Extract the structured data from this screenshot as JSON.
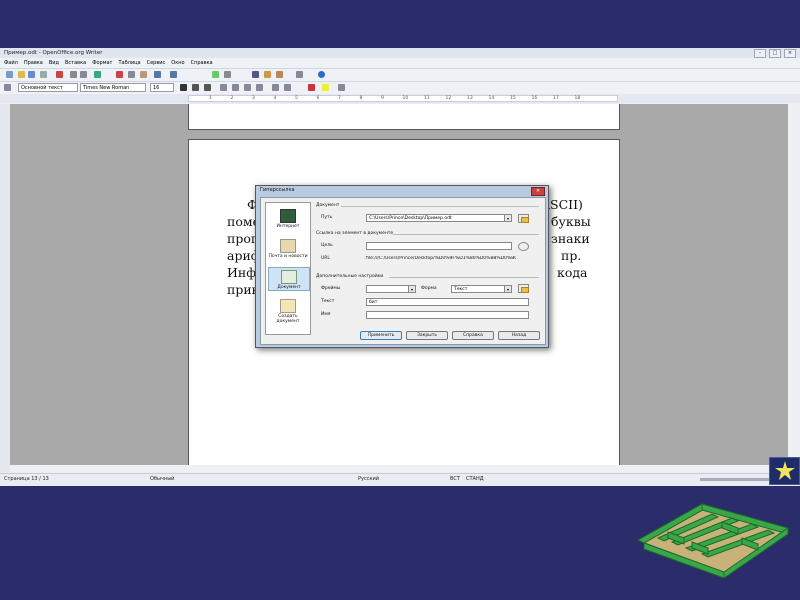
{
  "window": {
    "title": "Пример.odt - OpenOffice.org Writer"
  },
  "menu": [
    "Файл",
    "Правка",
    "Вид",
    "Вставка",
    "Формат",
    "Таблица",
    "Сервис",
    "Окно",
    "Справка"
  ],
  "format_bar": {
    "style": "Основной текст",
    "font": "Times New Roman",
    "size": "16"
  },
  "ruler_ticks": [
    "1",
    "2",
    "3",
    "4",
    "5",
    "6",
    "7",
    "8",
    "9",
    "10",
    "11",
    "12",
    "13",
    "14",
    "15",
    "16",
    "17",
    "18"
  ],
  "document": {
    "lines": [
      {
        "left": "Ф",
        "right": "ASCII)"
      },
      {
        "left": "поме",
        "right": "буквы"
      },
      {
        "left": "пропи",
        "right": "знаки"
      },
      {
        "left": "арифм",
        "right": "пр."
      },
      {
        "left": "Инфо",
        "right": "кода"
      },
      {
        "left": "прин",
        "right": ""
      }
    ]
  },
  "dialog": {
    "title": "Гиперссылка",
    "nav": [
      {
        "label": "Интернет"
      },
      {
        "label": "Почта и новости"
      },
      {
        "label": "Документ"
      },
      {
        "label": "Создать документ"
      }
    ],
    "group_document": "Документ",
    "path_label": "Путь",
    "path_value": "C:\\Users\\Prince\\Desktop\\Пример.odt",
    "group_target": "Ссылка на элемент в документе",
    "target_label": "Цель",
    "url_label": "URL",
    "url_value": "file:///C:/Users/Prince/Desktop/%D0%9F%D1%80%D0%B8%D0%BC",
    "group_extra": "Дополнительные настройки",
    "frame_label": "Фреймы",
    "form_label": "Форма",
    "form_value": "Текст",
    "text_label": "Текст",
    "text_value": "бит",
    "name_label": "Имя",
    "buttons": {
      "apply": "Применить",
      "close": "Закрыть",
      "help": "Справка",
      "back": "Назад"
    }
  },
  "status": {
    "page": "Страница 13 / 13",
    "style": "Обычный",
    "lang": "Русский",
    "mode1": "ВСТ",
    "mode2": "СТАНД"
  }
}
